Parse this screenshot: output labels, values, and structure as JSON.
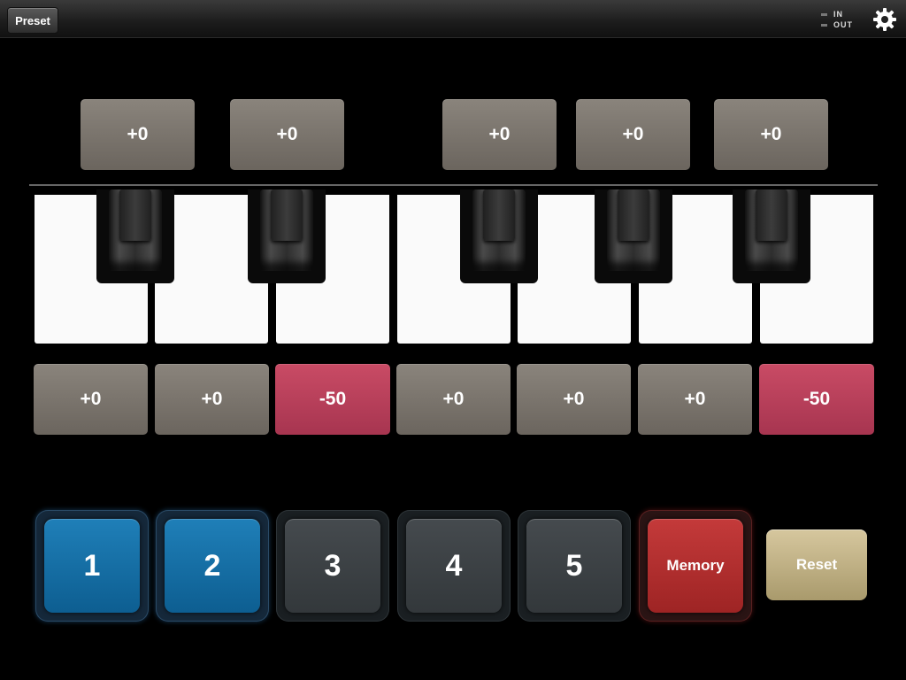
{
  "topbar": {
    "preset_label": "Preset",
    "io": {
      "in_label": "IN",
      "out_label": "OUT"
    },
    "settings_icon": "gear-icon"
  },
  "black_key_offsets": [
    "+0",
    "+0",
    "+0",
    "+0",
    "+0"
  ],
  "white_key_offsets": [
    "+0",
    "+0",
    "-50",
    "+0",
    "+0",
    "+0",
    "-50"
  ],
  "memory": {
    "slots": [
      "1",
      "2",
      "3",
      "4",
      "5"
    ],
    "active_slots": [
      "1",
      "2"
    ],
    "memory_label": "Memory",
    "reset_label": "Reset"
  },
  "colors": {
    "neutral_offset": "#7a746d",
    "negative_offset": "#b8405a",
    "active_slot": "#1270a8",
    "memory_button": "#b03030",
    "reset_button": "#c0b283"
  }
}
